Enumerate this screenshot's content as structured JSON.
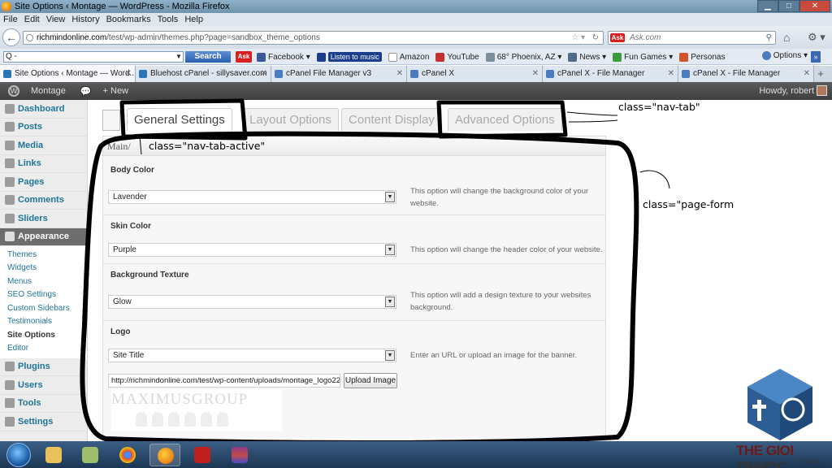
{
  "window": {
    "title": "Site Options ‹ Montage — WordPress - Mozilla Firefox"
  },
  "menubar": [
    "File",
    "Edit",
    "View",
    "History",
    "Bookmarks",
    "Tools",
    "Help"
  ],
  "address": {
    "host": "richmindonline.com",
    "path": "/test/wp-admin/themes.php?page=sandbox_theme_options",
    "search_placeholder": "Ask.com"
  },
  "bookmarks_bar": {
    "search_value": "Q -",
    "search_button": "Search",
    "ask_logo": "Ask",
    "items": [
      "Facebook ▾",
      "Listen to music",
      "Amazon",
      "YouTube",
      "68° Phoenix, AZ ▾",
      "News ▾",
      "Fun Games ▾",
      "Personas"
    ],
    "options": "Options ▾",
    "more": "»"
  },
  "tabs": [
    "Site Options ‹ Montage — Word...",
    "Bluehost cPanel - sillysaver.com",
    "cPanel File Manager v3",
    "cPanel X",
    "cPanel X - File Manager",
    "cPanel X - File Manager"
  ],
  "adminbar": {
    "site": "Montage",
    "new": "+ New",
    "howdy": "Howdy, robert"
  },
  "sidebar": {
    "top_items": [
      "Dashboard",
      "Posts",
      "Media",
      "Links",
      "Pages",
      "Comments",
      "Sliders"
    ],
    "appearance": "Appearance",
    "submenu": [
      "Themes",
      "Widgets",
      "Menus",
      "SEO Settings",
      "Custom Sidebars",
      "Testimonials",
      "Site Options",
      "Editor"
    ],
    "current": "Site Options",
    "bottom_items": [
      "Plugins",
      "Users",
      "Tools",
      "Settings"
    ]
  },
  "nav_tabs": [
    "General Settings",
    "Layout Options",
    "Content Display",
    "Advanced Options"
  ],
  "breadcrumb": "Main/",
  "form": {
    "body_color": {
      "label": "Body Color",
      "value": "Lavender",
      "desc": "This option will change the background color of your website."
    },
    "skin_color": {
      "label": "Skin Color",
      "value": "Purple",
      "desc": "This option will change the header color of your website."
    },
    "background_texture": {
      "label": "Background Texture",
      "value": "Glow",
      "desc": "This option will add a design texture to your websites background."
    },
    "logo": {
      "label": "Logo",
      "value": "Site Title",
      "desc": "Enter an URL or upload an image for the banner.",
      "url_value": "http://richmindonline.com/test/wp-content/uploads/montage_logo22.",
      "upload_label": "Upload Image",
      "preview_text": "MAXIMUSGROUP"
    }
  },
  "annotations": {
    "nav_tab": "class=\"nav-tab\"",
    "nav_tab_active": "class=\"nav-tab-active\"",
    "page_form": "class=\"page-form"
  },
  "watermark": {
    "brand_a": "THE GIOI ",
    "brand_b": "TINHOC",
    "domain": ".COM.VN"
  },
  "colors": {
    "wp_link": "#21759b",
    "annotation_ink": "#000000",
    "sidebar_active": "#6d6d6d"
  }
}
